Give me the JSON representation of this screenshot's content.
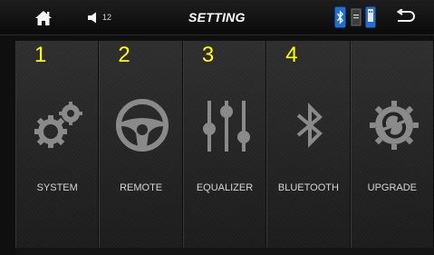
{
  "header": {
    "title": "SETTING",
    "volume_value": "12",
    "icons": {
      "home": "home-icon",
      "volume": "speaker-icon",
      "bluetooth_status": "bluetooth-status-icon",
      "card_status": "sd-card-icon",
      "usb_status": "usb-icon",
      "back": "back-arrow-icon"
    }
  },
  "tiles": [
    {
      "number": "1",
      "label": "SYSTEM",
      "icon": "gears-icon"
    },
    {
      "number": "2",
      "label": "REMOTE",
      "icon": "steering-wheel-icon"
    },
    {
      "number": "3",
      "label": "EQUALIZER",
      "icon": "equalizer-sliders-icon"
    },
    {
      "number": "4",
      "label": "BLUETOOTH",
      "icon": "bluetooth-icon"
    },
    {
      "number": "",
      "label": "UPGRADE",
      "icon": "upgrade-cycle-icon"
    }
  ],
  "colors": {
    "tile_number": "#ffff00",
    "label": "#d6d6d6",
    "icon": "#8c8c8c",
    "status_blue": "#1f6fd6"
  }
}
